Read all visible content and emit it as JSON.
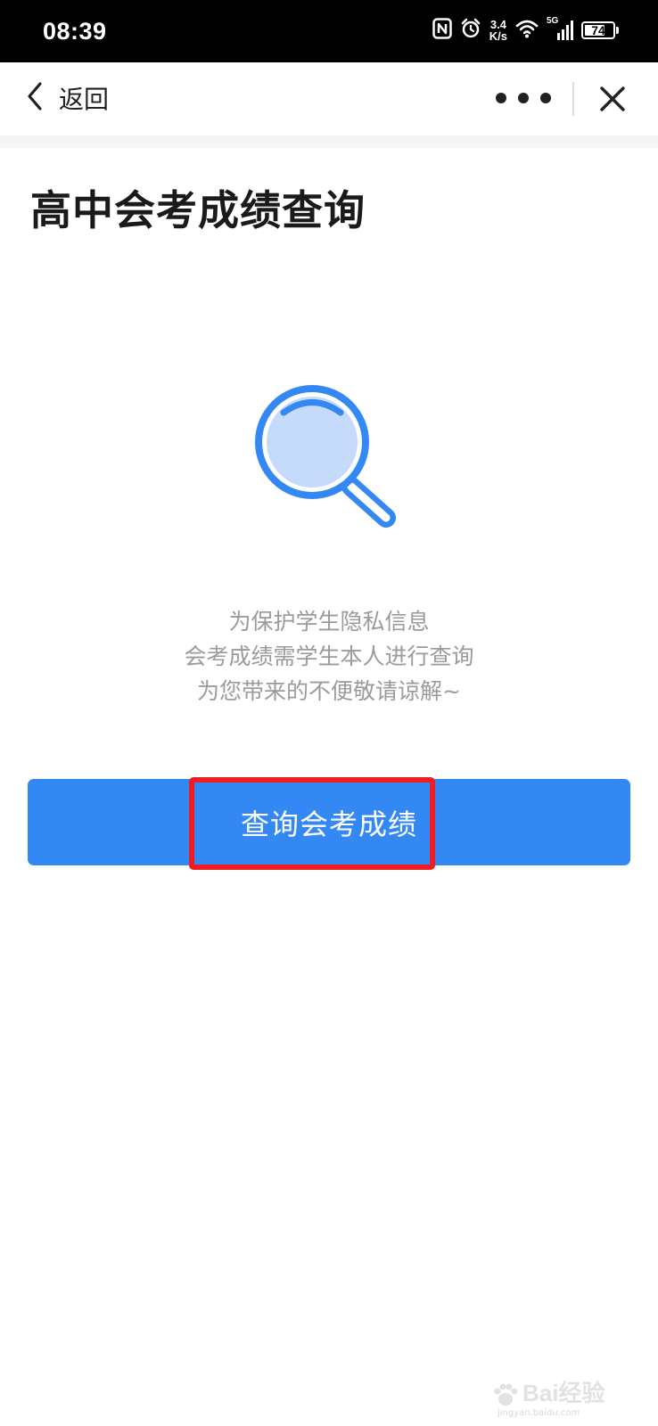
{
  "status_bar": {
    "time": "08:39",
    "net_speed_value": "3.4",
    "net_speed_unit": "K/s",
    "network_type": "5G",
    "battery_level": "74",
    "battery_fraction": 0.74,
    "icons": [
      "nfc-icon",
      "alarm-icon",
      "wifi-icon",
      "signal-icon",
      "battery-icon"
    ]
  },
  "nav": {
    "back_label": "返回",
    "icons": [
      "chevron-left-icon",
      "more-icon",
      "close-icon"
    ]
  },
  "page": {
    "title": "高中会考成绩查询",
    "illustration_icon": "search-icon",
    "message_lines": [
      "为保护学生隐私信息",
      "会考成绩需学生本人进行查询",
      "为您带来的不便敬请谅解~"
    ],
    "query_button_label": "查询会考成绩"
  },
  "watermark": {
    "text": "Bai经验",
    "sub": "jingyan.baidu.com"
  },
  "colors": {
    "primary": "#3488f4",
    "highlight": "#ee1c25",
    "message_text": "#9b9b9b",
    "status_bar_bg": "#000000"
  }
}
